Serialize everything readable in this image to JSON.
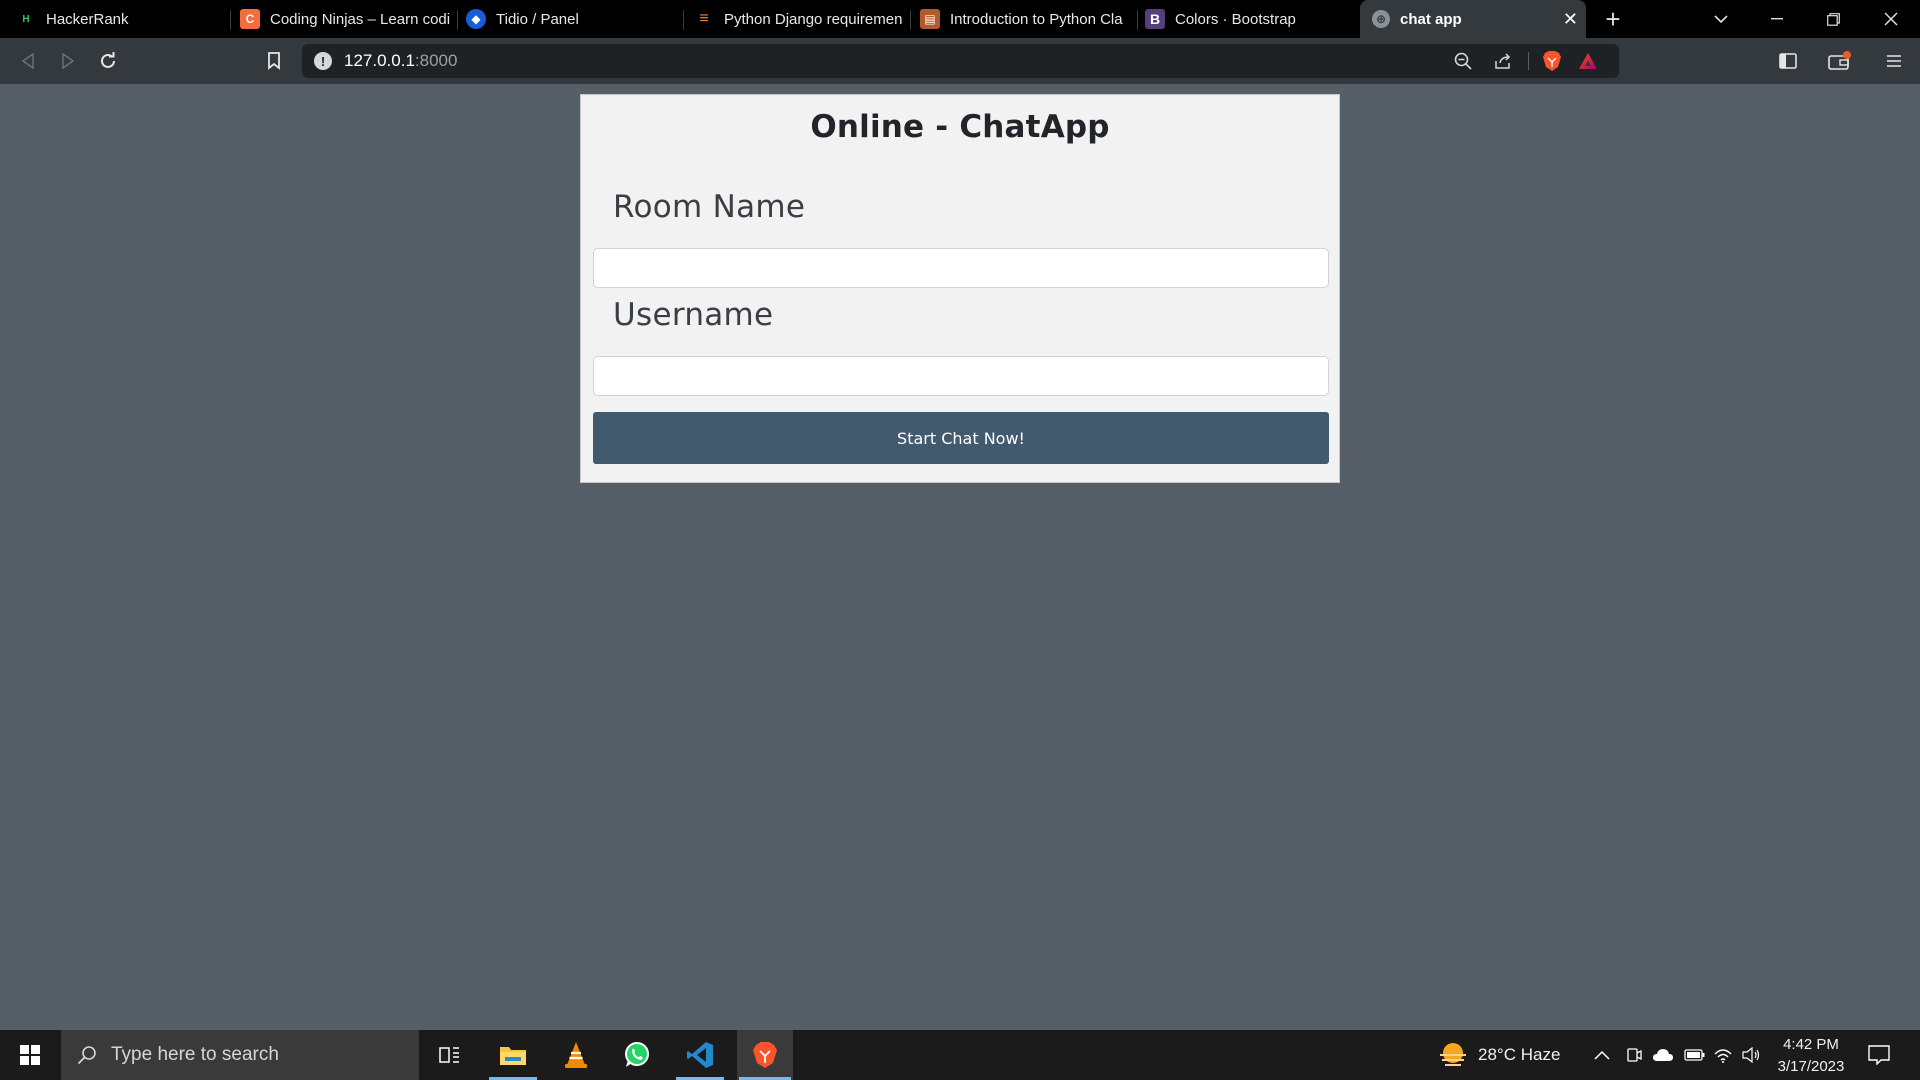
{
  "browser": {
    "tabs": [
      {
        "label": "HackerRank",
        "favicon": "hackerrank-icon"
      },
      {
        "label": "Coding Ninjas – Learn codi",
        "favicon": "coding-ninjas-icon"
      },
      {
        "label": "Tidio / Panel",
        "favicon": "tidio-icon"
      },
      {
        "label": "Python Django requiremen",
        "favicon": "stackoverflow-icon"
      },
      {
        "label": "Introduction to Python Cla",
        "favicon": "book-icon"
      },
      {
        "label": "Colors · Bootstrap",
        "favicon": "bootstrap-icon"
      },
      {
        "label": "chat app",
        "favicon": "globe-icon",
        "active": true
      }
    ],
    "url_host": "127.0.0.1",
    "url_port": ":8000"
  },
  "page": {
    "title": "Online - ChatApp",
    "room_label": "Room Name",
    "room_value": "",
    "username_label": "Username",
    "username_value": "",
    "start_button": "Start Chat Now!"
  },
  "taskbar": {
    "search_placeholder": "Type here to search",
    "weather": "28°C  Haze",
    "time": "4:42 PM",
    "date": "3/17/2023"
  },
  "colors": {
    "page_bg": "#565f67",
    "card_bg": "#f2f2f2",
    "button_bg": "#415a6d",
    "browser_toolbar": "#34393e",
    "tabstrip": "#000000"
  }
}
